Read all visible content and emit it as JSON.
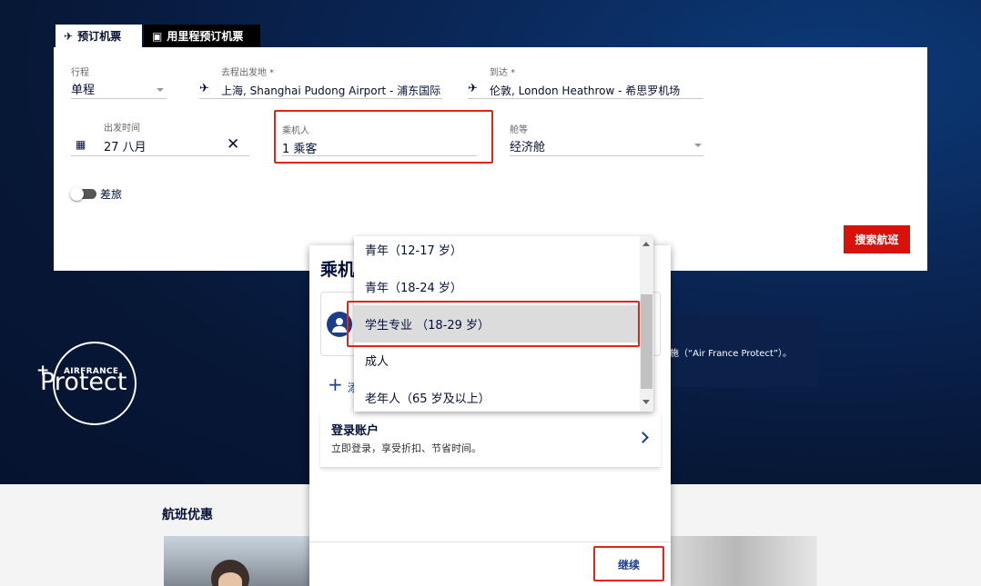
{
  "colors": {
    "brand_navy": "#051039",
    "accent_red": "#d8120b",
    "highlight_red": "#e1251b",
    "link_blue": "#1c3d8a"
  },
  "tabs": [
    {
      "label": "预订机票",
      "icon": "plane-icon",
      "active": true
    },
    {
      "label": "用里程预订机票",
      "icon": "miles-icon",
      "active": false
    }
  ],
  "form": {
    "trip": {
      "label": "行程",
      "value": "单程"
    },
    "origin": {
      "label": "去程出发地 *",
      "value": "上海, Shanghai Pudong Airport - 浦东国际"
    },
    "destination": {
      "label": "到达 *",
      "value": "伦敦, London Heathrow - 希思罗机场"
    },
    "date": {
      "label": "出发时间",
      "value": "27 八月"
    },
    "passengers": {
      "label": "乘机人",
      "value": "1 乘客"
    },
    "cabin": {
      "label": "舱等",
      "value": "经济舱"
    },
    "business_toggle": {
      "label": "差旅",
      "on": false
    },
    "search_button": "搜索航班"
  },
  "promo": {
    "brand": "AIRFRANCE",
    "product": "Protect",
    "text": "施（“Air France Protect”）。"
  },
  "offers": {
    "title": "航班优惠"
  },
  "modal": {
    "title": "乘机",
    "add_passenger_partial": "添",
    "login": {
      "title": "登录账户",
      "subtitle": "立即登录，享受折扣、节省时间。"
    },
    "continue_button": "继续"
  },
  "passenger_type_dropdown": {
    "options": [
      {
        "label": "青年（12-17 岁）",
        "selected": false
      },
      {
        "label": "青年（18-24 岁）",
        "selected": false
      },
      {
        "label": "学生专业 （18-29 岁）",
        "selected": true
      },
      {
        "label": "成人",
        "selected": false
      },
      {
        "label": "老年人（65 岁及以上）",
        "selected": false
      }
    ]
  }
}
